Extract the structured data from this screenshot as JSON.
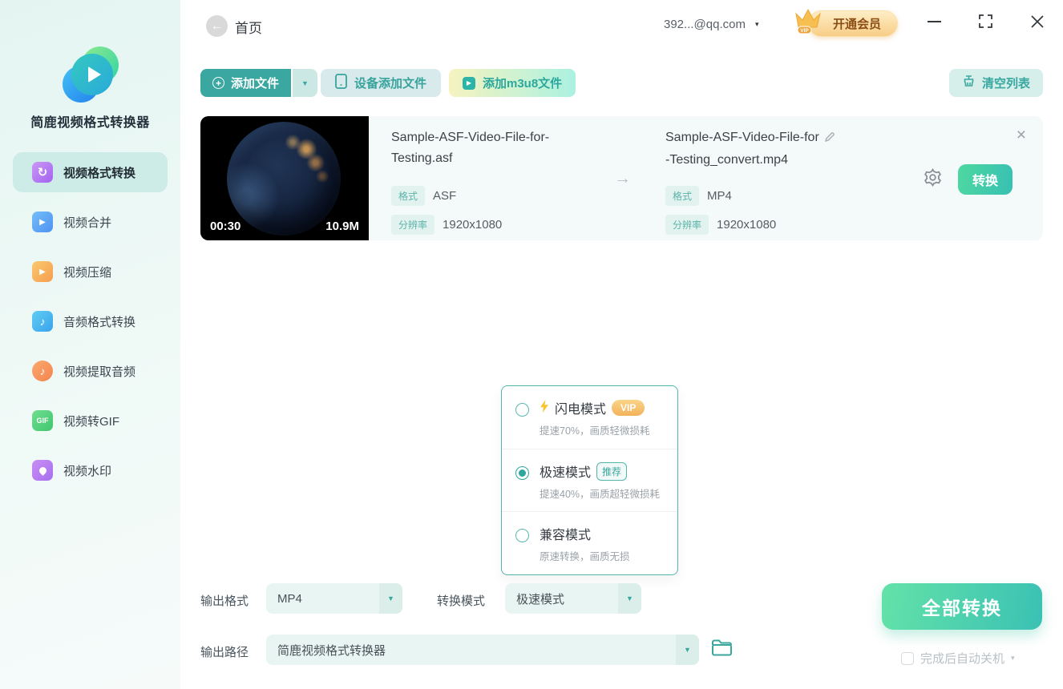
{
  "colors": {
    "accent": "#3aa7a0",
    "accent_light_bg": "#d6efeb",
    "convert_gradient_start": "#5fe0a7",
    "convert_gradient_end": "#3cc2b5",
    "vip_gold": "#f5b95c",
    "sidebar_bg": "#e9f7f4",
    "card_bg": "#f3faf9",
    "active_item_bg": "#cdece7"
  },
  "titlebar": {
    "home": "首页",
    "account": "392...@qq.com",
    "vip_button": "开通会员"
  },
  "sidebar": {
    "app_name": "简鹿视频格式转换器",
    "items": [
      {
        "label": "视频格式转换",
        "icon": "video-convert-icon",
        "glyph": "↻",
        "active": true
      },
      {
        "label": "视频合并",
        "icon": "video-merge-icon",
        "glyph": "▶",
        "active": false
      },
      {
        "label": "视频压缩",
        "icon": "video-compress-icon",
        "glyph": "▶",
        "active": false
      },
      {
        "label": "音频格式转换",
        "icon": "audio-convert-icon",
        "glyph": "♪",
        "active": false
      },
      {
        "label": "视频提取音频",
        "icon": "audio-extract-icon",
        "glyph": "♪",
        "active": false
      },
      {
        "label": "视频转GIF",
        "icon": "video-to-gif-icon",
        "glyph": "GIF",
        "active": false
      },
      {
        "label": "视频水印",
        "icon": "watermark-icon",
        "glyph": "drop-shape",
        "active": false
      }
    ]
  },
  "toolbar": {
    "add_file": "添加文件",
    "device_add": "设备添加文件",
    "add_m3u8": "添加m3u8文件",
    "clear_list": "清空列表"
  },
  "file_item": {
    "duration": "00:30",
    "size": "10.9M",
    "source": {
      "name_line1": "Sample-ASF-Video-File-for-",
      "name_line2": "Testing.asf",
      "format_label": "格式",
      "format": "ASF",
      "resolution_label": "分辨率",
      "resolution": "1920x1080"
    },
    "target": {
      "name_line1": "Sample-ASF-Video-File-for",
      "name_line2": "-Testing_convert.mp4",
      "format_label": "格式",
      "format": "MP4",
      "resolution_label": "分辨率",
      "resolution": "1920x1080"
    },
    "convert_button": "转换"
  },
  "mode_popup": {
    "options": [
      {
        "title": "闪电模式",
        "badge": "VIP",
        "desc": "提速70%，画质轻微损耗",
        "selected": false
      },
      {
        "title": "极速模式",
        "badge": "推荐",
        "desc": "提速40%，画质超轻微损耗",
        "selected": true
      },
      {
        "title": "兼容模式",
        "badge": "",
        "desc": "原速转换，画质无损",
        "selected": false
      }
    ]
  },
  "footer": {
    "output_format_label": "输出格式",
    "output_format_value": "MP4",
    "convert_mode_label": "转换模式",
    "convert_mode_value": "极速模式",
    "output_path_label": "输出路径",
    "output_path_value": "简鹿视频格式转换器",
    "convert_all_button": "全部转换",
    "shutdown_checkbox": "完成后自动关机"
  },
  "icons": {
    "back": "←",
    "caret_down": "▼",
    "caret_small": "▾",
    "arrow_right": "→",
    "close": "×",
    "plus": "+",
    "play": "▶"
  }
}
